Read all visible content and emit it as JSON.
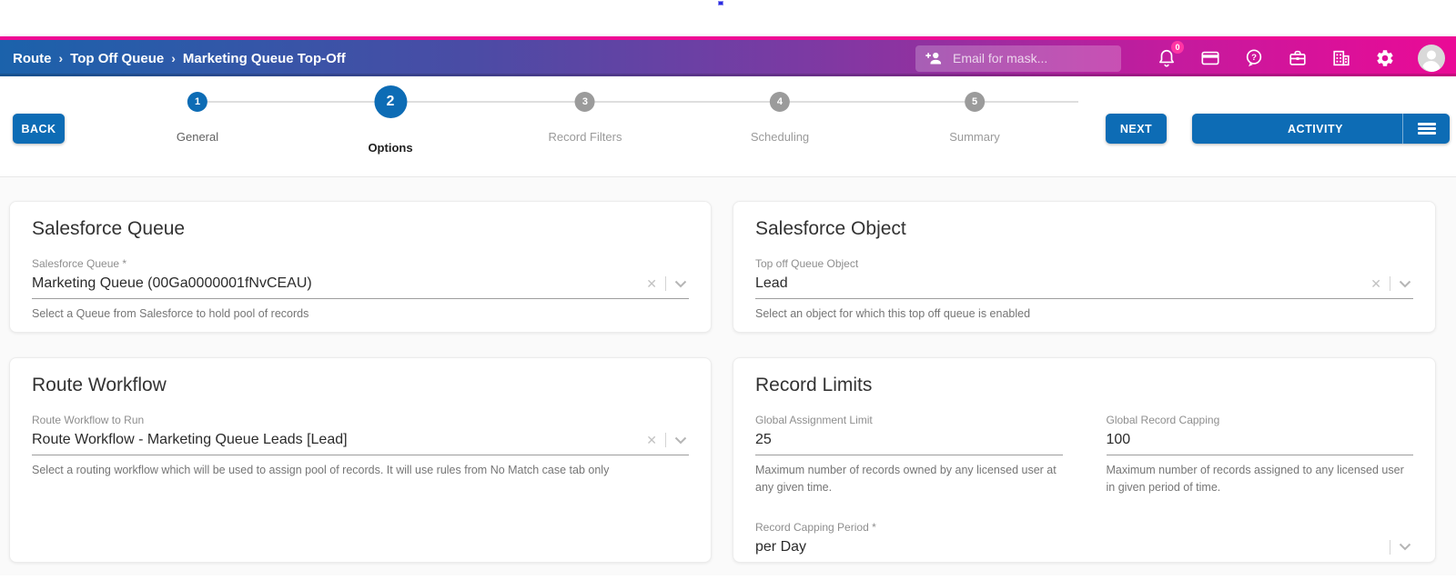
{
  "header": {
    "breadcrumb": [
      "Route",
      "Top Off Queue",
      "Marketing Queue Top-Off"
    ],
    "breadcrumb_separator": "›",
    "mask_placeholder": "Email for mask...",
    "notification_badge": "0",
    "icons": [
      "person-add-icon",
      "notifications-bell-icon",
      "card-icon",
      "help-icon",
      "briefcase-icon",
      "building-icon",
      "gear-icon",
      "avatar"
    ],
    "colors": {
      "top_strip": "#ee0b95",
      "gradient_left": "#1b62ab",
      "gradient_right": "#ea0a96"
    }
  },
  "stepper": {
    "back_label": "BACK",
    "next_label": "NEXT",
    "activity_label": "ACTIVITY",
    "steps": [
      {
        "number": "1",
        "label": "General",
        "state": "done"
      },
      {
        "number": "2",
        "label": "Options",
        "state": "active"
      },
      {
        "number": "3",
        "label": "Record Filters",
        "state": "upcoming"
      },
      {
        "number": "4",
        "label": "Scheduling",
        "state": "upcoming"
      },
      {
        "number": "5",
        "label": "Summary",
        "state": "upcoming"
      }
    ],
    "colors": {
      "accent_blue": "#0d6cb5",
      "inactive_gray": "#9b9b9b"
    }
  },
  "cards": {
    "salesforce_queue": {
      "title": "Salesforce Queue",
      "label": "Salesforce Queue *",
      "value": "Marketing Queue (00Ga0000001fNvCEAU)",
      "helper": "Select a Queue from Salesforce to hold pool of records"
    },
    "salesforce_object": {
      "title": "Salesforce Object",
      "label": "Top off Queue Object",
      "value": "Lead",
      "helper": "Select an object for which this top off queue is enabled"
    },
    "route_workflow": {
      "title": "Route Workflow",
      "label": "Route Workflow to Run",
      "value": "Route Workflow - Marketing Queue Leads [Lead]",
      "helper": "Select a routing workflow which will be used to assign pool of records. It will use rules from No Match case tab only"
    },
    "record_limits": {
      "title": "Record Limits",
      "assignment": {
        "label": "Global Assignment Limit",
        "value": "25",
        "helper": "Maximum number of records owned by any licensed user at any given time."
      },
      "capping": {
        "label": "Global Record Capping",
        "value": "100",
        "helper": "Maximum number of records assigned to any licensed user in given period of time."
      },
      "period": {
        "label": "Record Capping Period *",
        "value": "per Day"
      }
    }
  }
}
